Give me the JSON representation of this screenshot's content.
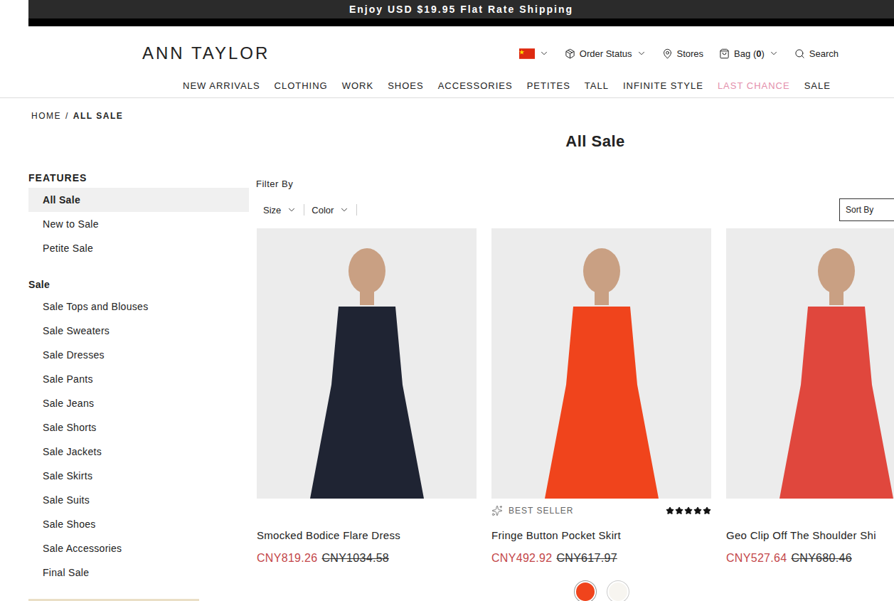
{
  "promo_bar": {
    "text": "Enjoy USD $19.95 Flat Rate Shipping"
  },
  "header": {
    "logo": "ANN TAYLOR",
    "utilities": [
      {
        "label": "Order Status",
        "kind": "order"
      },
      {
        "label": "Stores",
        "kind": "stores"
      },
      {
        "label": "Bag",
        "kind": "bag",
        "count_open": "(",
        "count": "0",
        "count_close": ")"
      },
      {
        "label": "Search",
        "kind": "search"
      }
    ]
  },
  "nav": [
    {
      "label": "NEW ARRIVALS",
      "color": "#222222"
    },
    {
      "label": "CLOTHING",
      "color": "#222222"
    },
    {
      "label": "WORK",
      "color": "#222222"
    },
    {
      "label": "SHOES",
      "color": "#222222"
    },
    {
      "label": "ACCESSORIES",
      "color": "#222222"
    },
    {
      "label": "PETITES",
      "color": "#222222"
    },
    {
      "label": "TALL",
      "color": "#222222"
    },
    {
      "label": "INFINITE STYLE",
      "color": "#222222"
    },
    {
      "label": "LAST CHANCE",
      "color": "#e48fab"
    },
    {
      "label": "SALE",
      "color": "#222222"
    }
  ],
  "breadcrumb": {
    "items": [
      "HOME",
      "ALL SALE"
    ],
    "separator": "/"
  },
  "page_title": "All Sale",
  "sidebar": {
    "sections": [
      {
        "title": "FEATURES",
        "items": [
          {
            "label": "All Sale",
            "selected": true
          },
          {
            "label": "New to Sale",
            "selected": false
          },
          {
            "label": "Petite Sale",
            "selected": false
          }
        ]
      },
      {
        "title": "Sale",
        "items": [
          {
            "label": "Sale Tops and Blouses",
            "selected": false
          },
          {
            "label": "Sale Sweaters",
            "selected": false
          },
          {
            "label": "Sale Dresses",
            "selected": false
          },
          {
            "label": "Sale Pants",
            "selected": false
          },
          {
            "label": "Sale Jeans",
            "selected": false
          },
          {
            "label": "Sale Shorts",
            "selected": false
          },
          {
            "label": "Sale Jackets",
            "selected": false
          },
          {
            "label": "Sale Skirts",
            "selected": false
          },
          {
            "label": "Sale Suits",
            "selected": false
          },
          {
            "label": "Sale Shoes",
            "selected": false
          },
          {
            "label": "Sale Accessories",
            "selected": false
          },
          {
            "label": "Final Sale",
            "selected": false
          }
        ]
      }
    ]
  },
  "filters": {
    "label": "Filter By",
    "dropdowns": [
      "Size",
      "Color"
    ],
    "sort": "Sort By"
  },
  "products": [
    {
      "name": "Smocked Bodice Flare Dress",
      "price": "CNY819.26",
      "original_price": "CNY1034.58",
      "color": "#1f2433"
    },
    {
      "name": "Fringe Button Pocket Skirt",
      "price": "CNY492.92",
      "original_price": "CNY617.97",
      "badge": "BEST SELLER",
      "stars": 5,
      "color": "#f0441c",
      "swatches": [
        {
          "color": "#f0441c",
          "selected": true
        },
        {
          "color": "#f7f5f0",
          "selected": false
        }
      ]
    },
    {
      "name": "Geo Clip Off The Shoulder Shi",
      "price": "CNY527.64",
      "original_price": "CNY680.46",
      "color": "#e0473d"
    }
  ]
}
